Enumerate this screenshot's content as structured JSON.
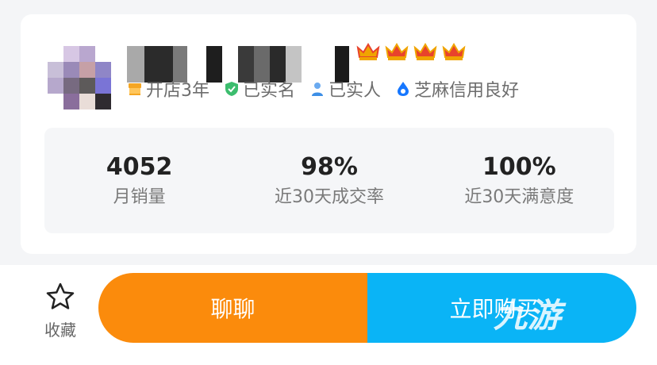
{
  "seller": {
    "tags": [
      {
        "icon": "shop-icon",
        "label": "开店3年",
        "color": "#f5a623"
      },
      {
        "icon": "verified-check-icon",
        "label": "已实名",
        "color": "#3cbd6e"
      },
      {
        "icon": "person-icon",
        "label": "已实人",
        "color": "#3d8fe6"
      },
      {
        "icon": "sesame-drop-icon",
        "label": "芝麻信用良好",
        "color": "#1677ff"
      }
    ]
  },
  "stats": [
    {
      "value": "4052",
      "label": "月销量"
    },
    {
      "value": "98%",
      "label": "近30天成交率"
    },
    {
      "value": "100%",
      "label": "近30天满意度"
    }
  ],
  "bottom_bar": {
    "favorite_label": "收藏",
    "chat_label": "聊聊",
    "buy_label": "立即购买",
    "watermark": "九游"
  },
  "colors": {
    "chat_button": "#fb8b0c",
    "buy_button": "#0ab4f6",
    "crown": "#e8432c"
  }
}
